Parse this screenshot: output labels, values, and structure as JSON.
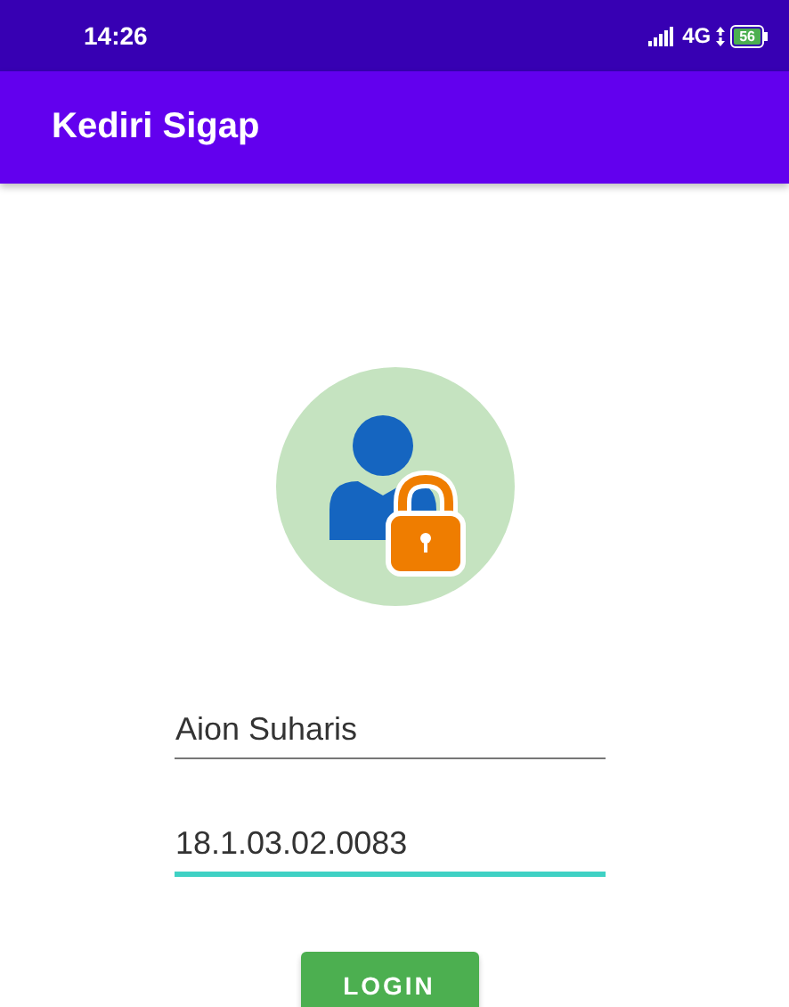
{
  "status_bar": {
    "time": "14:26",
    "network": "4G",
    "battery": "56"
  },
  "app_bar": {
    "title": "Kediri Sigap"
  },
  "fields": [
    {
      "value": "Aion Suharis",
      "focused": false
    },
    {
      "value": "18.1.03.02.0083",
      "focused": true
    }
  ],
  "button": {
    "label": "LOGIN"
  }
}
